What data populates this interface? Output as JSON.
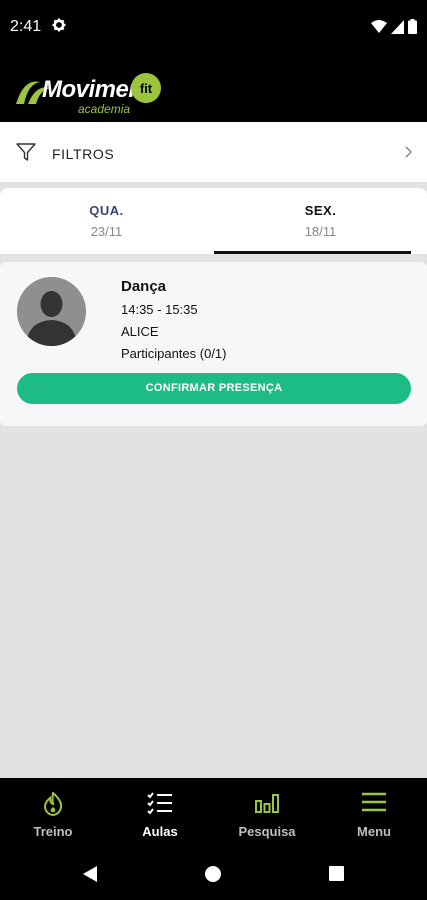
{
  "status_bar": {
    "time": "2:41",
    "icons": [
      "settings-icon",
      "wifi-icon",
      "signal-icon",
      "battery-icon"
    ]
  },
  "app": {
    "logo_text": "Moviment",
    "logo_fit": "fit",
    "logo_subtext": "academia",
    "brand_color": "#9bc53d"
  },
  "filters": {
    "label": "FILTROS",
    "icon": "filter-icon",
    "chevron": "chevron-right-icon"
  },
  "tabs": [
    {
      "day": "QUA.",
      "date": "23/11",
      "active": false
    },
    {
      "day": "SEX.",
      "date": "18/11",
      "active": true
    }
  ],
  "class_card": {
    "name": "Dança",
    "time": "14:35 - 15:35",
    "teacher": "ALICE",
    "participants": "Participantes (0/1)",
    "confirm_label": "CONFIRMAR PRESENÇA",
    "accent_color": "#1dbc84"
  },
  "bottom_nav": [
    {
      "label": "Treino",
      "icon": "flame-icon",
      "active": false
    },
    {
      "label": "Aulas",
      "icon": "checklist-icon",
      "active": true
    },
    {
      "label": "Pesquisa",
      "icon": "bar-chart-icon",
      "active": false
    },
    {
      "label": "Menu",
      "icon": "hamburger-menu-icon",
      "active": false
    }
  ],
  "system_nav": [
    "back-icon",
    "home-icon",
    "recents-icon"
  ]
}
